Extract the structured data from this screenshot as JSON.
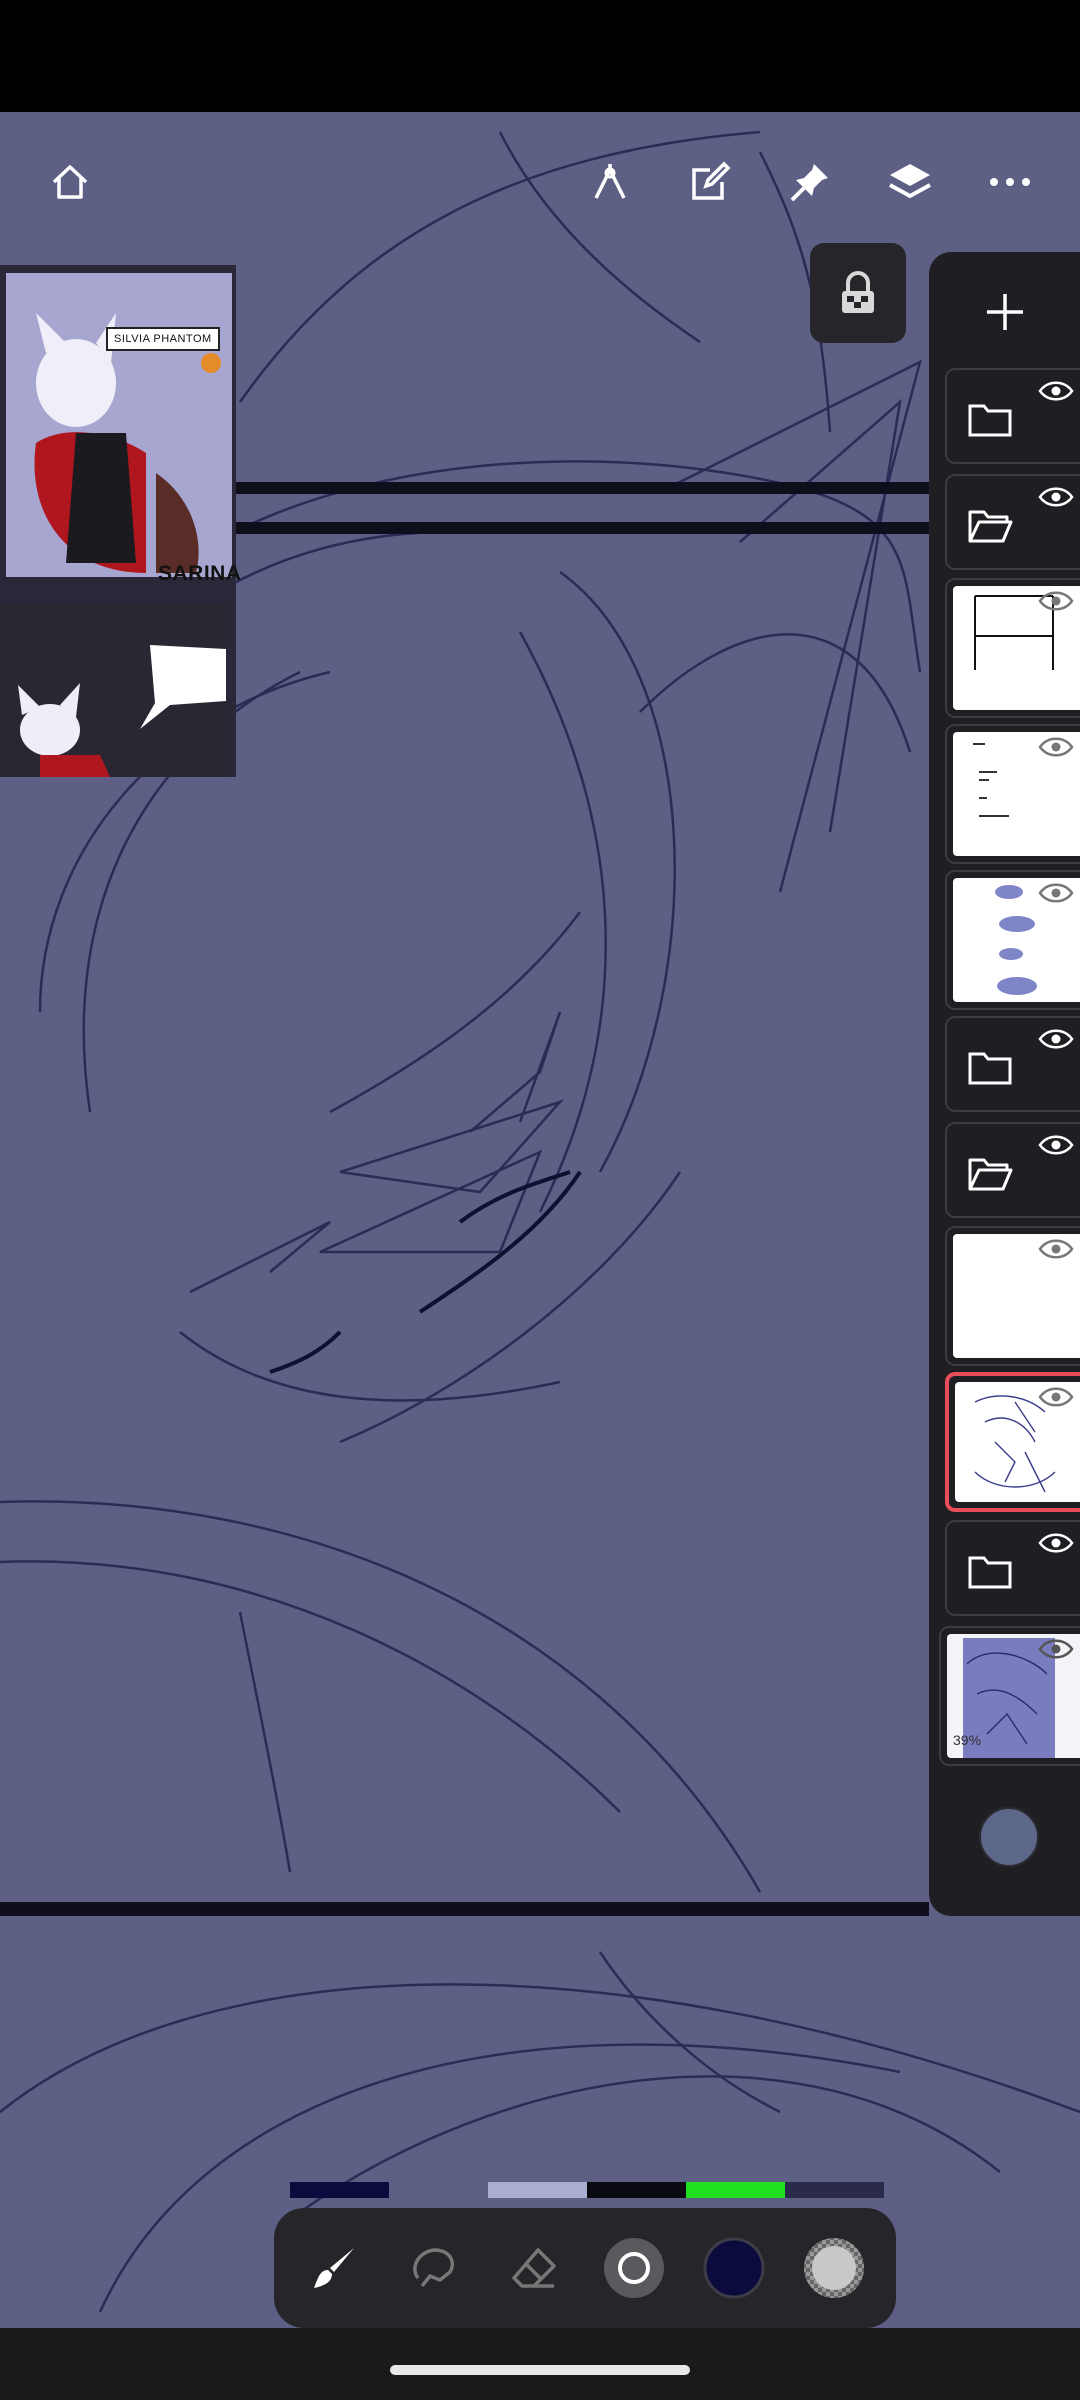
{
  "reference_panel": {
    "caption_top": "SILVIA PHANTOM",
    "caption_bottom": "SARINA"
  },
  "toolbar": {
    "home_icon": "home-icon",
    "ruler_icon": "ruler-icon",
    "edit_icon": "edit-icon",
    "pin_icon": "pin-icon",
    "layers_icon": "layers-icon",
    "more_icon": "more-icon"
  },
  "layers": {
    "add_icon": "plus-icon",
    "items": [
      {
        "type": "folder",
        "state": "closed"
      },
      {
        "type": "folder",
        "state": "open"
      },
      {
        "type": "layer",
        "thumb": "panel-frame"
      },
      {
        "type": "layer",
        "thumb": "text"
      },
      {
        "type": "layer",
        "thumb": "speech-bubbles"
      },
      {
        "type": "folder",
        "state": "closed"
      },
      {
        "type": "folder",
        "state": "open"
      },
      {
        "type": "layer",
        "thumb": "blank"
      },
      {
        "type": "layer",
        "thumb": "sketch",
        "selected": true
      },
      {
        "type": "folder",
        "state": "closed"
      },
      {
        "type": "layer",
        "thumb": "background"
      }
    ],
    "opacity_label": "39%",
    "layer_color": "#5c6789"
  },
  "palette": {
    "colors": [
      "#0b0b3e",
      "#5d5f85",
      "#a9aed0",
      "#0a0a12",
      "#1fe01f",
      "#2a2a4a"
    ]
  },
  "bottom_tools": {
    "brush_icon": "brush-icon",
    "lasso_icon": "lasso-icon",
    "eraser_icon": "eraser-icon",
    "brush_size_icon": "brush-size-icon",
    "color": "#0b0b3e",
    "opacity_icon": "opacity-icon"
  }
}
